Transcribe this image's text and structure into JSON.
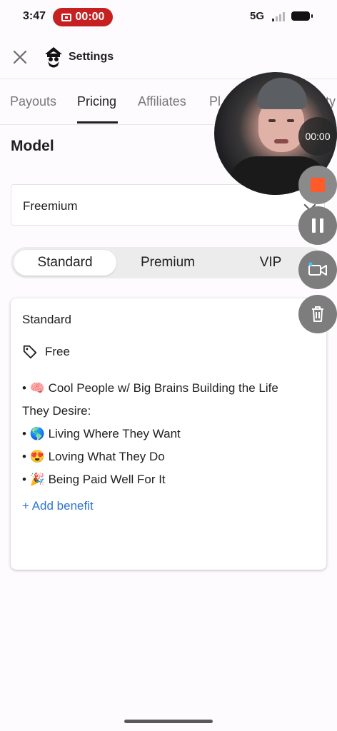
{
  "status": {
    "time": "3:47",
    "recording": "00:00",
    "network": "5G"
  },
  "header": {
    "title": "Settings"
  },
  "tabs": [
    {
      "label": "Payouts"
    },
    {
      "label": "Pricing"
    },
    {
      "label": "Affiliates"
    },
    {
      "label": "Pl"
    },
    {
      "label": "ity"
    }
  ],
  "model": {
    "title": "Model",
    "selected": "Freemium"
  },
  "tiers": [
    {
      "label": "Standard"
    },
    {
      "label": "Premium"
    },
    {
      "label": "VIP"
    }
  ],
  "card": {
    "title": "Standard",
    "price": "Free",
    "benefits": [
      "• 🧠 Cool People w/ Big Brains Building the Life They Desire:",
      "• 🌎 Living Where They Want",
      "• 😍 Loving What They Do",
      "• 🎉 Being Paid Well For It"
    ],
    "add_benefit": "+ Add benefit"
  },
  "overlay": {
    "timer": "00:00"
  },
  "colors": {
    "accent": "#2f74d0",
    "record_red": "#c62020",
    "stop_orange": "#ff5a2a"
  }
}
